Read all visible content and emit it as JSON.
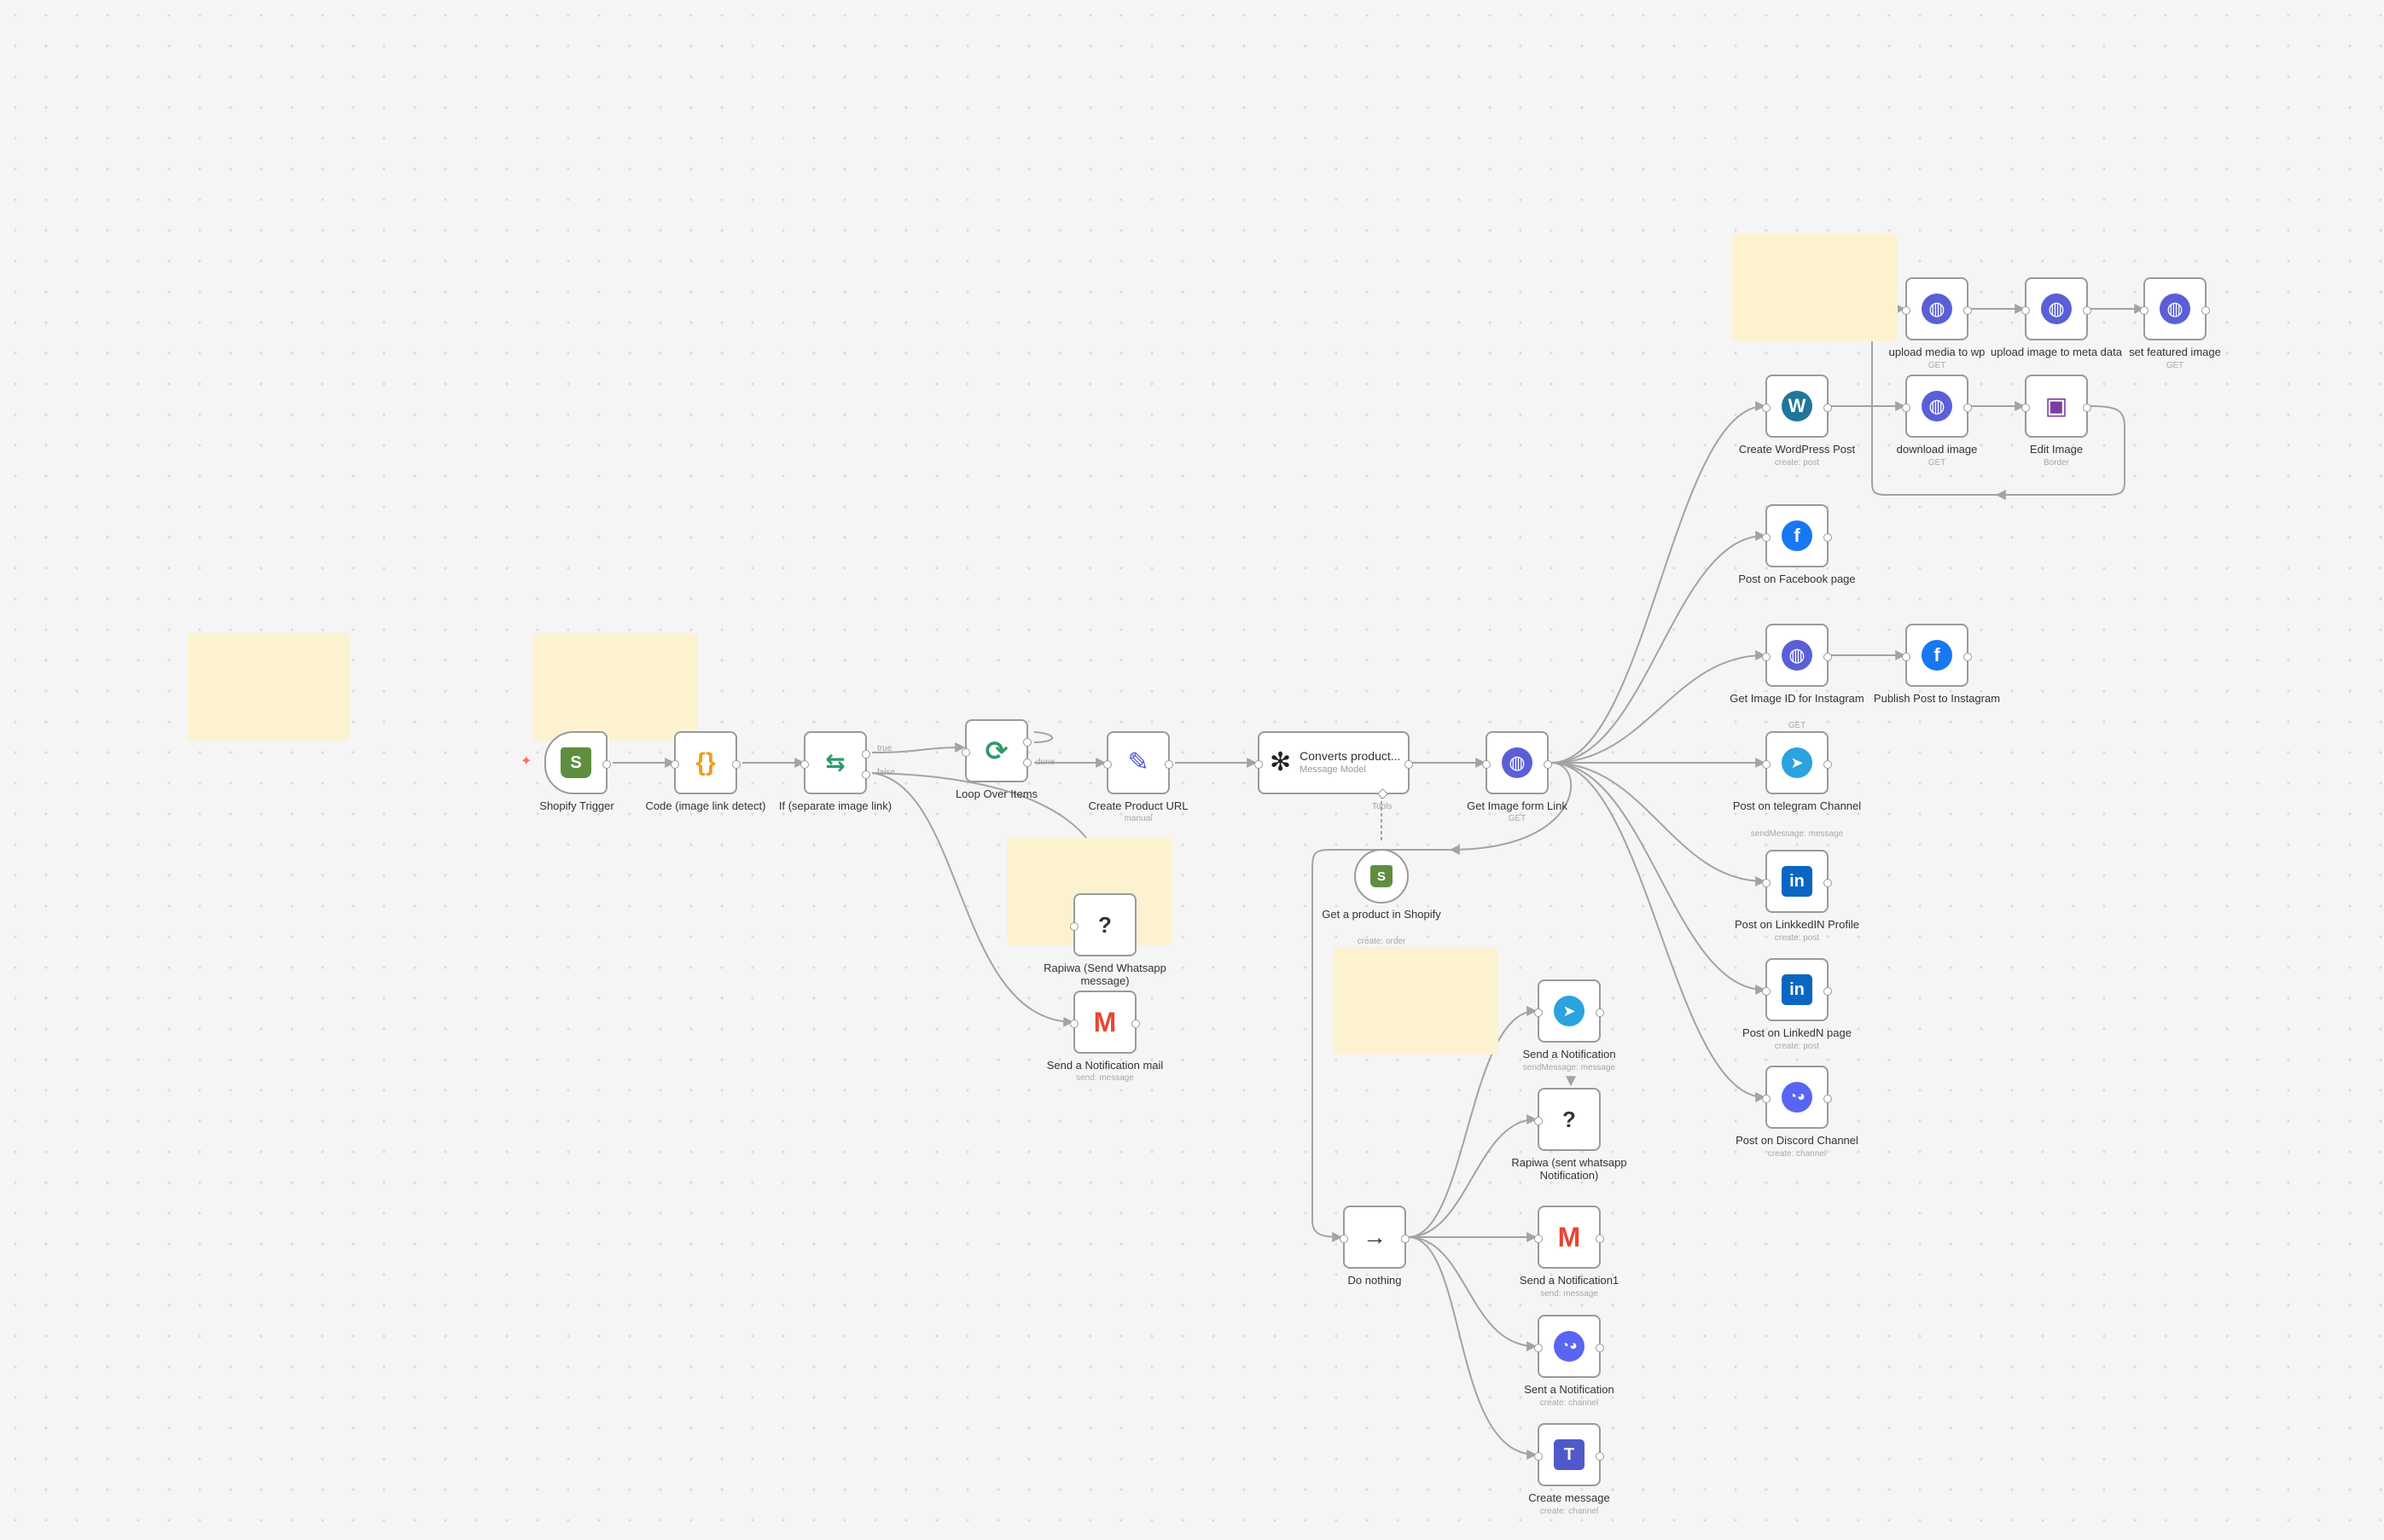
{
  "nodes": {
    "shopify_trigger": {
      "label": "Shopify Trigger"
    },
    "code": {
      "label": "Code (image link detect)"
    },
    "if_node": {
      "label": "If (separate image link)"
    },
    "loop": {
      "label": "Loop Over Items"
    },
    "create_url": {
      "label": "Create Product URL",
      "sub": "manual"
    },
    "openai": {
      "title": "Converts product...",
      "sub": "Message Model"
    },
    "get_image": {
      "label": "Get Image form Link",
      "sub": "GET"
    },
    "rapiwa1": {
      "label": "Rapiwa (Send Whatsapp message)"
    },
    "mail1": {
      "label": "Send a Notification mail",
      "sub": "send: message"
    },
    "get_product": {
      "label": "Get a product in Shopify",
      "sub": "create: order"
    },
    "do_nothing": {
      "label": "Do nothing"
    },
    "tg_notify": {
      "label": "Send a Notification",
      "sub": "sendMessage: message"
    },
    "rapiwa2": {
      "label": "Rapiwa (sent whatsapp Notification)"
    },
    "mail2": {
      "label": "Send a Notification1",
      "sub": "send: message"
    },
    "discord_notify": {
      "label": "Sent a Notification",
      "sub": "create: channel"
    },
    "teams": {
      "label": "Create message",
      "sub": "create: channel"
    },
    "wp_post": {
      "label": "Create WordPress Post",
      "sub": "create: post"
    },
    "fb_page": {
      "label": "Post on Facebook page"
    },
    "ig_id": {
      "label": "Get Image ID for Instagram",
      "sub": "GET"
    },
    "ig_publish": {
      "label": "Publish Post to Instagram"
    },
    "tg_channel": {
      "label": "Post on telegram Channel",
      "sub": "sendMessage: message"
    },
    "li_profile": {
      "label": "Post on LinkkedIN Profile",
      "sub": "create: post"
    },
    "li_page": {
      "label": "Post on LinkedN page",
      "sub": "create: post"
    },
    "discord_channel": {
      "label": "Post on Discord Channel",
      "sub": "create: channel"
    },
    "upload_wp": {
      "label": "upload media to wp",
      "sub": "GET"
    },
    "upload_meta": {
      "label": "upload image to meta data",
      "sub": "GET"
    },
    "set_featured": {
      "label": "set featured image",
      "sub": "GET"
    },
    "download_image": {
      "label": "download image",
      "sub": "GET"
    },
    "edit_image": {
      "label": "Edit Image",
      "sub": "Border"
    }
  },
  "edge_labels": {
    "if_true": "true",
    "if_false": "false",
    "loop_done": "done",
    "tools": "Tools"
  },
  "colors": {
    "edge": "#a3a3a3",
    "node_border": "#9a9a9a",
    "sticky": "#fdf2d0",
    "http_globe": "#5b5fd6",
    "shopify": "#5e8e3e",
    "code": "#f29c1f",
    "if_green": "#2e9a6b",
    "loop_green": "#2e9a6b",
    "pen": "#4d56cf",
    "facebook": "#1877f2",
    "telegram": "#2aa3df",
    "linkedin": "#0a66c2",
    "discord": "#5865f2",
    "wordpress": "#21759b",
    "teams": "#5059c9",
    "trigger_bolt": "#ff6d5a"
  }
}
